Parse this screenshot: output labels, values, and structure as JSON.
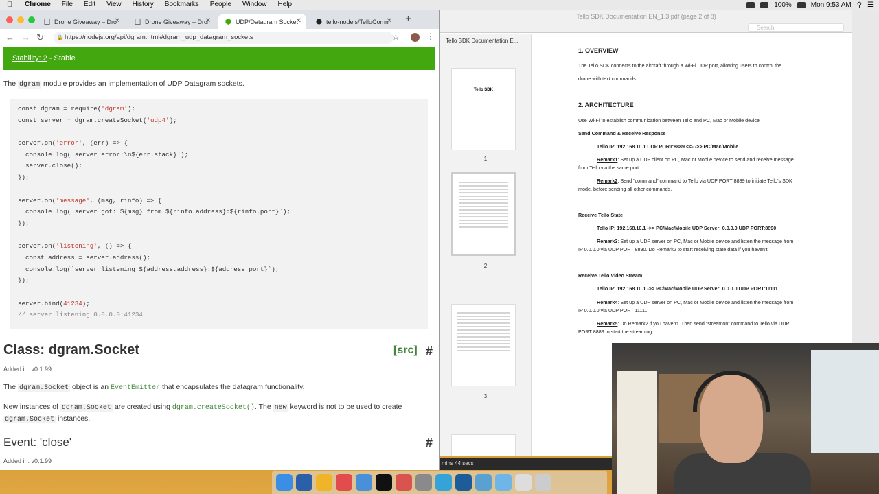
{
  "menubar": {
    "app": "Chrome",
    "items": [
      "File",
      "Edit",
      "View",
      "History",
      "Bookmarks",
      "People",
      "Window",
      "Help"
    ],
    "battery": "100%",
    "clock": "Mon 9:53 AM"
  },
  "browser": {
    "tabs": [
      {
        "title": "Drone Giveaway – Dron"
      },
      {
        "title": "Drone Giveaway – Dron"
      },
      {
        "title": "UDP/Datagram Socket"
      },
      {
        "title": "tello-nodejs/TelloComm"
      }
    ],
    "url": "https://nodejs.org/api/dgram.html#dgram_udp_datagram_sockets"
  },
  "doc": {
    "stability_link": "Stability: 2",
    "stability_text": "- Stable",
    "intro_pre": "The",
    "intro_code": "dgram",
    "intro_post": "module provides an implementation of UDP Datagram sockets.",
    "code": [
      {
        "a": "const dgram = require(",
        "s": "'dgram'",
        "b": ");"
      },
      {
        "a": "const server = dgram.createSocket(",
        "s": "'udp4'",
        "b": ");"
      },
      {
        "a": "",
        "s": "",
        "b": ""
      },
      {
        "a": "server.on(",
        "s": "'error'",
        "b": ", (err) => {"
      },
      {
        "a": "  console.log(`server error:\\n${err.stack}`);",
        "s": "",
        "b": ""
      },
      {
        "a": "  server.close();",
        "s": "",
        "b": ""
      },
      {
        "a": "});",
        "s": "",
        "b": ""
      },
      {
        "a": "",
        "s": "",
        "b": ""
      },
      {
        "a": "server.on(",
        "s": "'message'",
        "b": ", (msg, rinfo) => {"
      },
      {
        "a": "  console.log(`server got: ${msg} from ${rinfo.address}:${rinfo.port}`);",
        "s": "",
        "b": ""
      },
      {
        "a": "});",
        "s": "",
        "b": ""
      },
      {
        "a": "",
        "s": "",
        "b": ""
      },
      {
        "a": "server.on(",
        "s": "'listening'",
        "b": ", () => {"
      },
      {
        "a": "  const address = server.address();",
        "s": "",
        "b": ""
      },
      {
        "a": "  console.log(`server listening ${address.address}:${address.port}`);",
        "s": "",
        "b": ""
      },
      {
        "a": "});",
        "s": "",
        "b": ""
      },
      {
        "a": "",
        "s": "",
        "b": ""
      },
      {
        "a": "server.bind(",
        "s": "41234",
        "b": ");"
      },
      {
        "a": "",
        "s": "",
        "b": "",
        "c": "// server listening 0.0.0.0:41234"
      }
    ],
    "class_heading": "Class: dgram.Socket",
    "src_link": "[src]",
    "hash": "#",
    "added1": "Added in: v0.1.99",
    "p1_pre": "The",
    "p1_code": "dgram.Socket",
    "p1_mid": "object is an",
    "p1_link": "EventEmitter",
    "p1_post": "that encapsulates the datagram functionality.",
    "p2_pre": "New instances of",
    "p2_code": "dgram.Socket",
    "p2_mid": "are created using",
    "p2_link": "dgram.createSocket()",
    "p2_mid2": ". The",
    "p2_code2": "new",
    "p2_post": "keyword is not to be used to create",
    "p2_code3": "dgram.Socket",
    "p2_end": "instances.",
    "event_heading": "Event: 'close'",
    "added2": "Added in: v0.1.99"
  },
  "pdf": {
    "window_title": "Tello SDK Documentation EN_1.3.pdf (page 2 of 8)",
    "search_placeholder": "Search",
    "sidebar_title": "Tello SDK Documentation E...",
    "thumb1_title": "Tello SDK",
    "page_numbers": [
      "1",
      "2",
      "3"
    ],
    "lines": {
      "h1": "1. OVERVIEW",
      "l1": "The Tello SDK connects to the aircraft through a Wi-Fi UDP port, allowing users to control the",
      "l2": "drone with text commands.",
      "h2": "2. ARCHITECTURE",
      "l3": "Use Wi-Fi to establish communication between Tello and PC, Mac or Mobile device",
      "s1": "Send Command & Receive Response",
      "ip1": "Tello IP: 192.168.10.1  UDP PORT:8889  <<- ->>  PC/Mac/Mobile",
      "r1k": "Remark1",
      "r1": ": Set up a UDP client on PC, Mac or Mobile device to send and receive message",
      "r1b": "from Tello via the same port.",
      "r2k": "Remark2",
      "r2": ": Send “command” command to Tello via UDP PORT 8889 to initiate Tello’s SDK",
      "r2b": "mode, before sending all other commands.",
      "s2": "Receive Tello State",
      "ip2": "Tello IP: 192.168.10.1  ->>  PC/Mac/Mobile UDP Server: 0.0.0.0 UDP PORT:8890",
      "r3k": "Remark3",
      "r3": ": Set up a UDP server on PC, Mac or Mobile device and listen the message from",
      "r3b": "IP 0.0.0.0 via UDP PORT 8890. Do Remark2 to start receiving state data if you haven’t.",
      "s3": "Receive Tello Video Stream",
      "ip3": "Tello IP: 192.168.10.1  ->>  PC/Mac/Mobile UDP Server: 0.0.0.0 UDP PORT:11111",
      "r4k": "Remark4",
      "r4": ": Set up a UDP server on PC, Mac or Mobile device and listen the message from",
      "r4b": "IP 0.0.0.0 via UDP PORT 11111.",
      "r5k": "Remark5",
      "r5": ": Do Remark2 if you haven’t. Then send “streamon” command to Tello via UDP",
      "r5b": "PORT 8889 to start the streaming."
    }
  },
  "overlay": {
    "timer_text": "mins 44 secs"
  },
  "colors": {
    "node_green": "#43a80f",
    "link_green": "#43853d"
  }
}
